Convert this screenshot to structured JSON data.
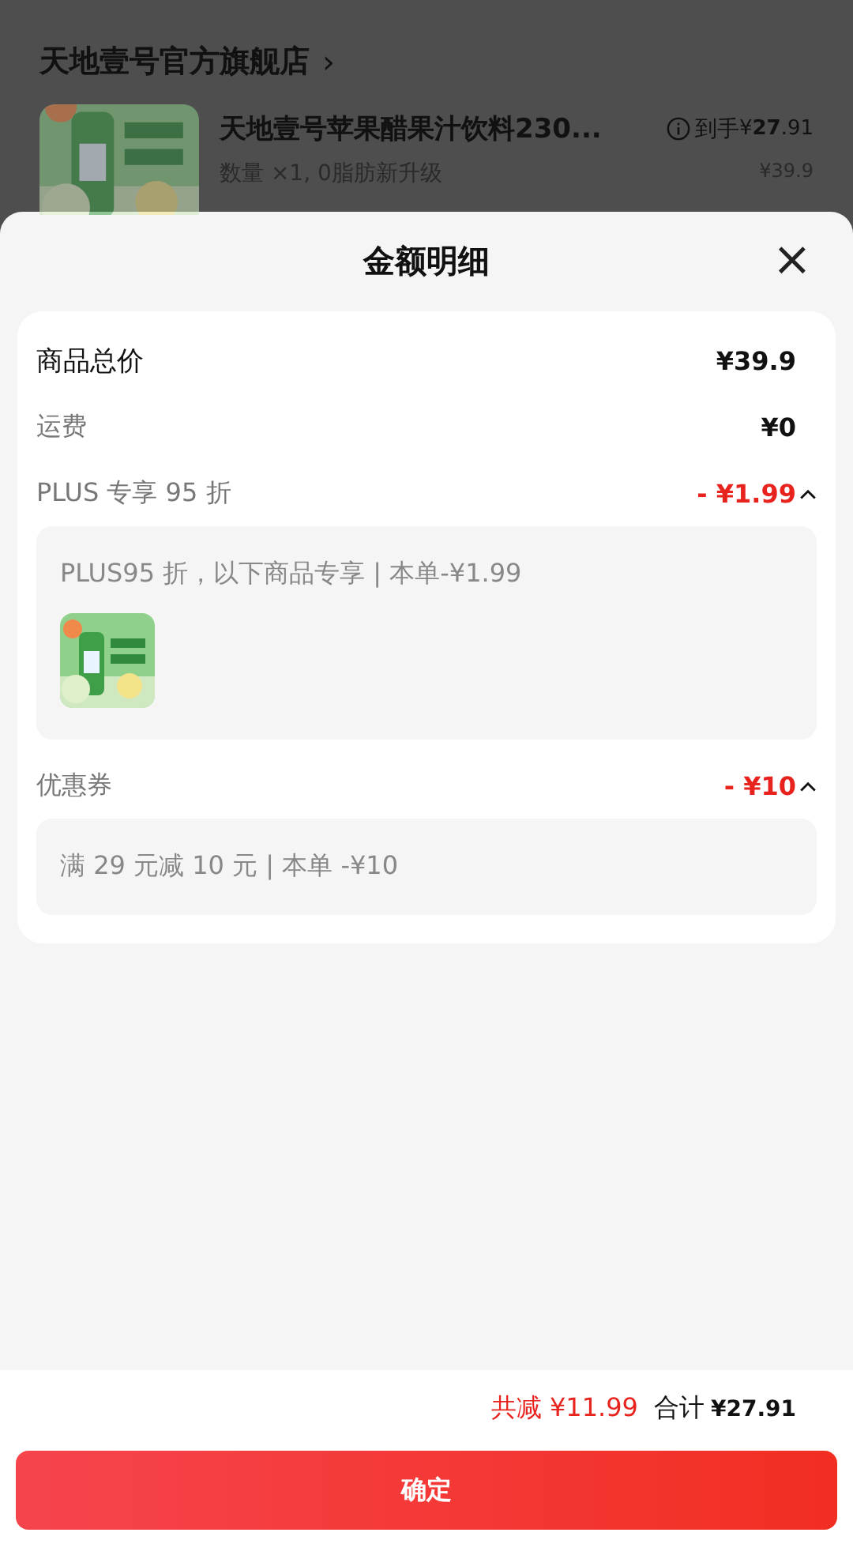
{
  "background_page": {
    "store_name": "天地壹号官方旗舰店",
    "store_chevron": "›",
    "product": {
      "kind": "picture",
      "title": "天地壹号苹果醋果汁饮料230...",
      "subtitle": "数量 ×1, 0脂肪新升级",
      "final_label": "到手",
      "final_price": "¥**27**.91",
      "original_price": "¥39.9"
    }
  },
  "sheet": {
    "title": "金额明细",
    "close": "×"
  },
  "rows": [
    {
      "kind": "total",
      "label": "商品总价",
      "value": "¥39.9"
    },
    {
      "kind": "line",
      "label": "运费",
      "value": "¥0"
    },
    {
      "kind": "discount",
      "label": "PLUS 专享 95 折",
      "value": "- ¥1.99",
      "expanded": true,
      "detail": "PLUS95 折，以下商品专享 | 本单-¥1.99"
    },
    {
      "kind": "discount",
      "label": "优惠券",
      "value": "- ¥10",
      "expanded": true,
      "detail": "满 29 元减 10 元 | 本单 -¥10"
    }
  ],
  "footer": {
    "saved": "共减 ¥11.99",
    "total_label": "合计",
    "total": "¥**27**.91",
    "confirm_button": "确定"
  }
}
